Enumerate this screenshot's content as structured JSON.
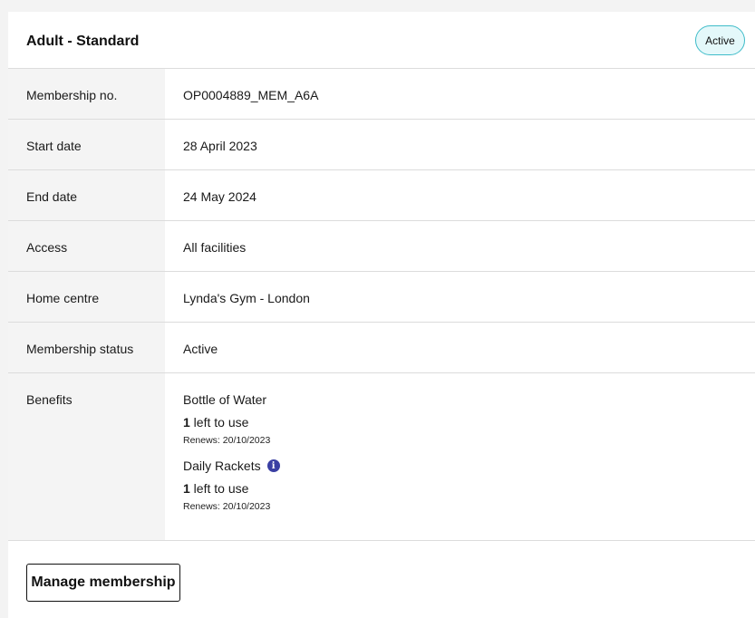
{
  "membership": {
    "title": "Adult - Standard",
    "status_badge": "Active",
    "colors": {
      "badge_border": "#3fbcc9",
      "badge_bg": "#e4f8fa",
      "info_icon": "#3a3fa3"
    }
  },
  "details": [
    {
      "label": "Membership no.",
      "value": "OP0004889_MEM_A6A"
    },
    {
      "label": "Start date",
      "value": "28 April 2023"
    },
    {
      "label": "End date",
      "value": "24 May 2024"
    },
    {
      "label": "Access",
      "value": "All facilities"
    },
    {
      "label": "Home centre",
      "value": "Lynda's Gym - London"
    },
    {
      "label": "Membership status",
      "value": "Active"
    }
  ],
  "benefits": {
    "label": "Benefits",
    "items": [
      {
        "name": "Bottle of Water",
        "count": "1",
        "count_suffix": " left to use",
        "renews": "Renews: 20/10/2023",
        "info_icon": false
      },
      {
        "name": "Daily Rackets",
        "count": "1",
        "count_suffix": " left to use",
        "renews": "Renews: 20/10/2023",
        "info_icon": true,
        "icon_glyph": "i"
      }
    ]
  },
  "actions": {
    "manage_label": "Manage membership"
  }
}
